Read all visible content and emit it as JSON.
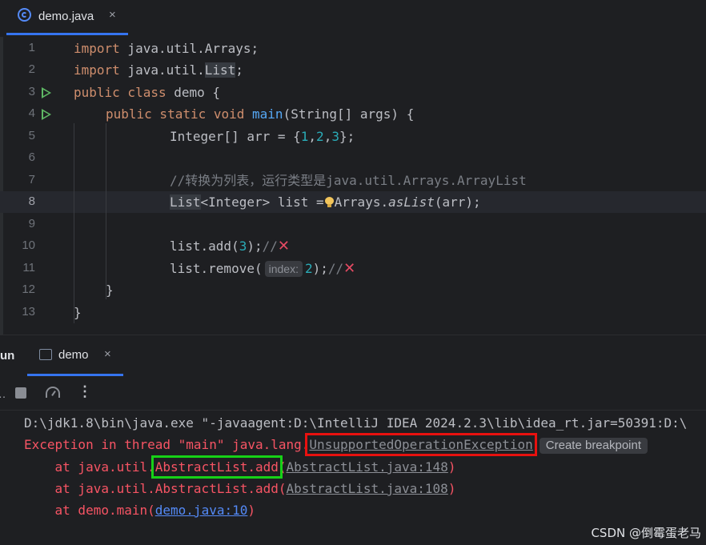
{
  "editor_tab": {
    "label": "demo.java",
    "close": "×"
  },
  "gutter": {
    "line_numbers": [
      "1",
      "2",
      "3",
      "4",
      "5",
      "6",
      "7",
      "8",
      "9",
      "10",
      "11",
      "12",
      "13"
    ],
    "active_line": "8"
  },
  "code": {
    "l1": {
      "kw": "import",
      "rest": " java.util.Arrays;"
    },
    "l2": {
      "kw": "import",
      "pre": " java.util.",
      "hl": "List",
      "post": ";"
    },
    "l3": {
      "kw": "public class",
      "rest": " demo {"
    },
    "l4": {
      "kw": "public static void",
      "sp": " ",
      "fn": "main",
      "rest": "(String[] args) {"
    },
    "l5": {
      "pre": "Integer[] arr = {",
      "n1": "1",
      "c1": ",",
      "n2": "2",
      "c2": ",",
      "n3": "3",
      "post": "};"
    },
    "l7": {
      "comment": "//转换为列表，运行类型是java.util.Arrays.ArrayList"
    },
    "l8": {
      "hl": "List",
      "mid": "<Integer> list =",
      "pre2": "Arrays.",
      "it": "asList",
      "post": "(arr);"
    },
    "l10": {
      "pre": "list.add(",
      "num": "3",
      "post": ");",
      "cmt": "//"
    },
    "l11": {
      "pre": "list.remove(",
      "hint": "index:",
      "num": "2",
      "post": ");",
      "cmt": "//"
    },
    "l12": {
      "text": "}"
    },
    "l13": {
      "text": "}"
    }
  },
  "run_panel": {
    "side_label": "un",
    "tab_label": "demo",
    "tab_close": "×",
    "more": "⋮",
    "dots": "‥"
  },
  "console": {
    "cmd": "D:\\jdk1.8\\bin\\java.exe \"-javaagent:D:\\IntelliJ IDEA 2024.2.3\\lib\\idea_rt.jar=50391:D:\\",
    "exc_prefix": "Exception in thread \"main\" java.lang.",
    "exc_class": "UnsupportedOperationException",
    "create_breakpoint": "Create breakpoint",
    "t1_pre": "    at java.util.",
    "t1_method": "AbstractList.add",
    "t1_paren": "(",
    "t1_link": "AbstractList.java:148",
    "t1_post": ")",
    "t2_pre": "    at java.util.AbstractList.add(",
    "t2_link": "AbstractList.java:108",
    "t2_post": ")",
    "t3_pre": "    at demo.main(",
    "t3_link": "demo.java:10",
    "t3_post": ")"
  },
  "watermark": "CSDN @倒霉蛋老马",
  "colors": {
    "background": "#1e1f22",
    "keyword": "#cf8e6d",
    "function": "#56a8f5",
    "number": "#2aacb8",
    "error": "#f75464",
    "annotation_red": "#e8110f",
    "annotation_green": "#17d117"
  },
  "icons": {
    "file": "java-class-icon",
    "run": "run-gutter-icon",
    "stop": "stop-icon",
    "profiler": "gauge-icon",
    "more": "more-vertical-icon",
    "error_mark": "red-x-icon",
    "intention": "lightbulb-icon"
  }
}
